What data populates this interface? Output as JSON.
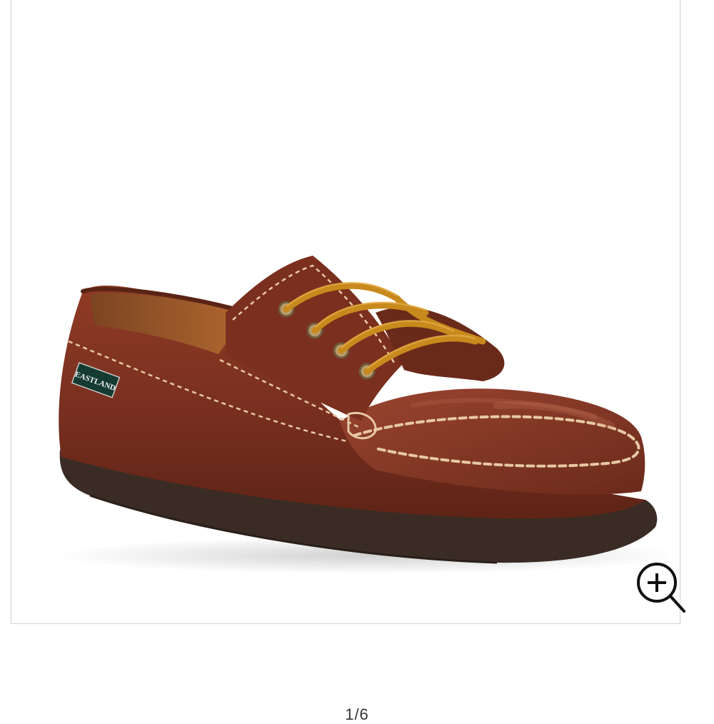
{
  "product_image": {
    "brand_label": "EASTLAND",
    "colors": {
      "leather": "#7a3020",
      "sole": "#3a2c24",
      "laces": "#c8891d",
      "stitch": "#e7c9a4"
    }
  },
  "zoom_button": {
    "icon": "zoom-in-icon"
  },
  "gallery": {
    "counter": "1/6"
  }
}
